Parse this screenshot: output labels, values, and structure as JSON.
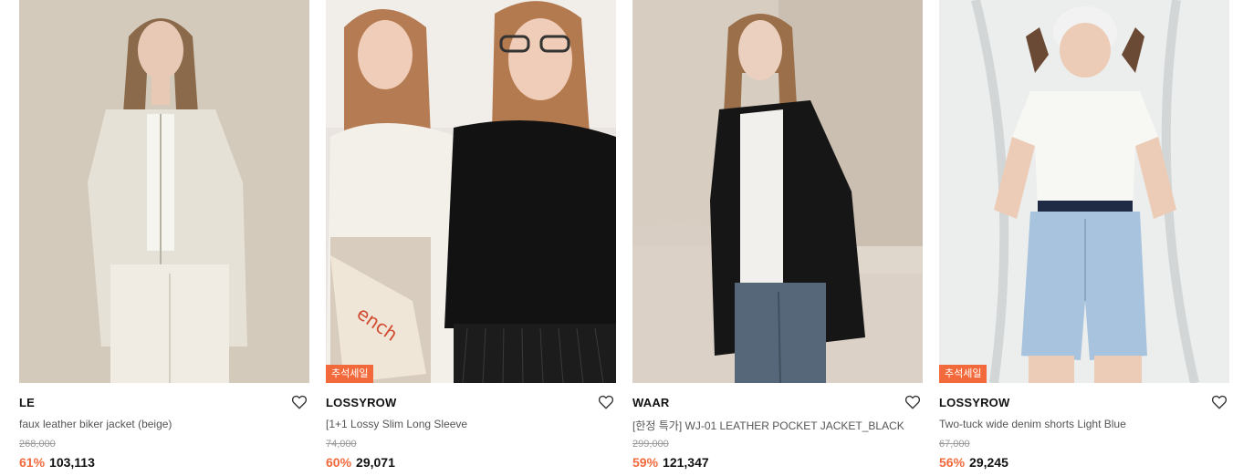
{
  "products": [
    {
      "brand": "LE",
      "name": "faux leather biker jacket (beige)",
      "original_price": "268,000",
      "discount": "61%",
      "price": "103,113",
      "badge": ""
    },
    {
      "brand": "LOSSYROW",
      "name": "[1+1 Lossy Slim Long Sleeve",
      "original_price": "74,000",
      "discount": "60%",
      "price": "29,071",
      "badge": "추석세일"
    },
    {
      "brand": "WAAR",
      "name": "[한정 특가] WJ-01 LEATHER POCKET JACKET_BLACK",
      "original_price": "299,000",
      "discount": "59%",
      "price": "121,347",
      "badge": ""
    },
    {
      "brand": "LOSSYROW",
      "name": "Two-tuck wide denim shorts Light Blue",
      "original_price": "67,000",
      "discount": "56%",
      "price": "29,245",
      "badge": "추석세일"
    }
  ],
  "icons": {
    "wishlist": "heart-outline-icon"
  },
  "colors": {
    "accent": "#f26a3b",
    "price": "#111111",
    "muted": "#999999"
  }
}
